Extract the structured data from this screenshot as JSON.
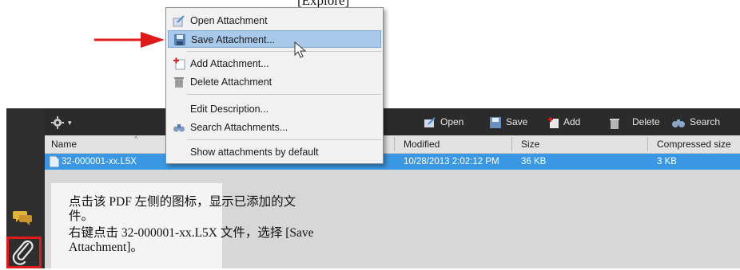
{
  "top_fragment": "[Explore]",
  "context_menu": {
    "items": [
      {
        "label": "Open Attachment",
        "icon": "open-attachment-icon"
      },
      {
        "label": "Save Attachment...",
        "icon": "save-attachment-icon",
        "highlighted": true
      },
      {
        "label": "Add Attachment...",
        "icon": "add-attachment-icon"
      },
      {
        "label": "Delete Attachment",
        "icon": "trash-icon"
      },
      {
        "label": "Edit Description..."
      },
      {
        "label": "Search Attachments...",
        "icon": "search-binoculars-icon"
      },
      {
        "label": "Show attachments by default"
      }
    ]
  },
  "toolbar": {
    "gear_icon": "gear-icon",
    "open_label": "Open",
    "save_label": "Save",
    "add_label": "Add",
    "delete_label": "Delete",
    "search_label": "Search"
  },
  "table": {
    "columns": [
      "Name",
      "Modified",
      "Size",
      "Compressed size"
    ],
    "rows": [
      {
        "name": "32-000001-xx.L5X",
        "modified": "10/28/2013 2:02:12 PM",
        "size": "36 KB",
        "compressed": "3 KB"
      }
    ]
  },
  "note": {
    "line1": "点击该 PDF 左侧的图标，显示已添加的文",
    "line2": "件。",
    "line3": "右键点击 32-000001-xx.L5X 文件，选择 [Save",
    "line4": "Attachment]。"
  },
  "colors": {
    "arrow": "#e01a1a",
    "selection": "#3a97e3",
    "menu_highlight": "#a9c9ea",
    "toolbar": "#2b2b2b"
  }
}
